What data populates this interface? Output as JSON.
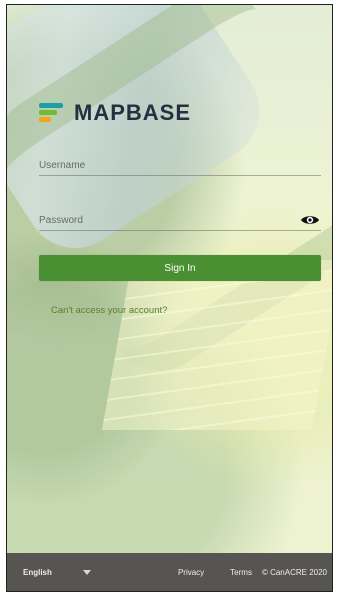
{
  "app": {
    "brand": "MAPBASE"
  },
  "form": {
    "username_label": "Username",
    "password_label": "Password",
    "signin_label": "Sign In",
    "help_text": "Can't access your account?"
  },
  "footer": {
    "language": "English",
    "privacy": "Privacy",
    "terms": "Terms",
    "copyright": "© CanACRE 2020"
  },
  "icons": {
    "password_toggle": "eye-icon",
    "language_dropdown": "chevron-down-icon"
  },
  "colors": {
    "accent": "#4b8f33",
    "footer_bg": "#575551",
    "logo_blue": "#1e9fa7",
    "logo_green": "#6fbc33",
    "logo_orange": "#f0a51b"
  }
}
